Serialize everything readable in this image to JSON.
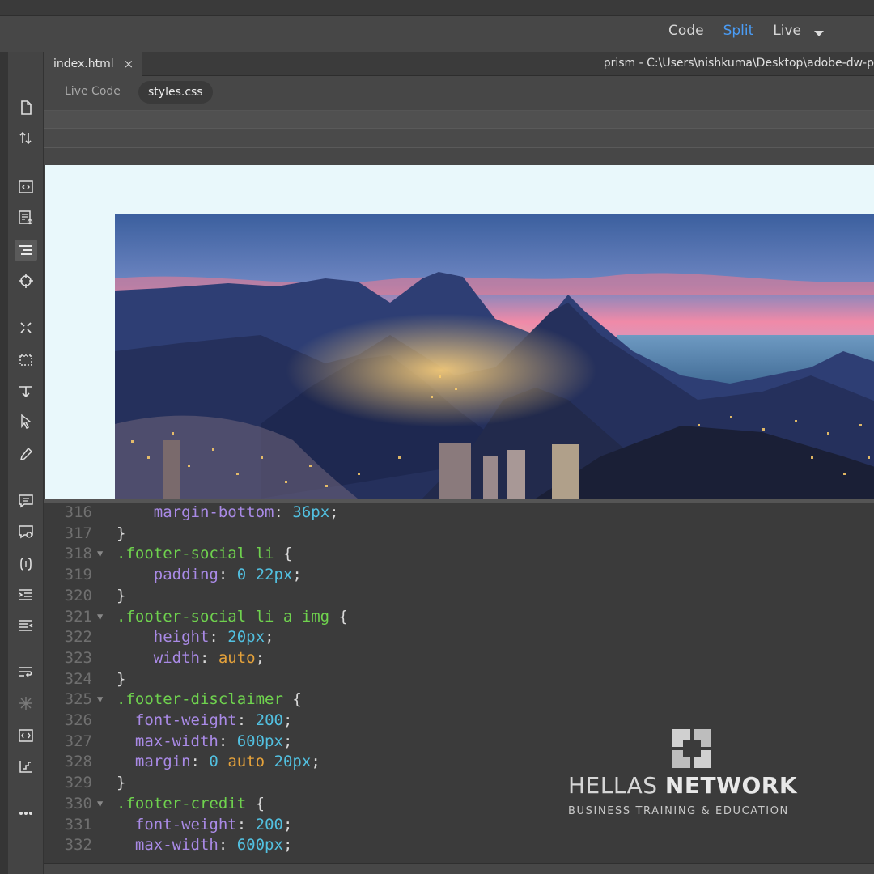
{
  "view_switcher": {
    "code": "Code",
    "split": "Split",
    "live": "Live",
    "active": "Split"
  },
  "document_tab": {
    "filename": "index.html",
    "close_glyph": "×"
  },
  "document_path": "prism - C:\\Users\\nishkuma\\Desktop\\adobe-dw-p",
  "related_files": {
    "live_code": "Live Code",
    "stylesheet": "styles.css"
  },
  "left_toolbar": [
    {
      "icon": "new-file-icon"
    },
    {
      "icon": "expand-collapse-icon"
    },
    {
      "icon": "code-view-icon"
    },
    {
      "icon": "inspect-icon"
    },
    {
      "icon": "format-source-icon",
      "active": true
    },
    {
      "icon": "target-icon"
    },
    {
      "icon": "collapse-selection-icon"
    },
    {
      "icon": "expand-all-icon"
    },
    {
      "icon": "select-parent-tag-icon"
    },
    {
      "icon": "cursor-select-icon"
    },
    {
      "icon": "eyedropper-icon"
    },
    {
      "icon": "comment-icon"
    },
    {
      "icon": "remove-comment-icon"
    },
    {
      "icon": "wrap-tag-icon"
    },
    {
      "icon": "indent-icon"
    },
    {
      "icon": "outdent-icon"
    },
    {
      "icon": "word-wrap-icon"
    },
    {
      "icon": "sparkle-icon"
    },
    {
      "icon": "live-code-icon"
    },
    {
      "icon": "hierarchy-icon"
    },
    {
      "icon": "more-icon"
    }
  ],
  "code_lines": [
    {
      "n": "316",
      "fold": false,
      "indent": "    ",
      "tokens": [
        [
          "prop",
          "margin-bottom"
        ],
        [
          "pun",
          ": "
        ],
        [
          "num",
          "36px"
        ],
        [
          "pun",
          ";"
        ]
      ]
    },
    {
      "n": "317",
      "fold": false,
      "indent": "",
      "tokens": [
        [
          "pun",
          "}"
        ]
      ]
    },
    {
      "n": "318",
      "fold": true,
      "indent": "",
      "tokens": [
        [
          "sel",
          ".footer-social li"
        ],
        [
          "pun",
          " {"
        ]
      ]
    },
    {
      "n": "319",
      "fold": false,
      "indent": "    ",
      "tokens": [
        [
          "prop",
          "padding"
        ],
        [
          "pun",
          ": "
        ],
        [
          "num",
          "0"
        ],
        [
          "pun",
          " "
        ],
        [
          "num",
          "22px"
        ],
        [
          "pun",
          ";"
        ]
      ]
    },
    {
      "n": "320",
      "fold": false,
      "indent": "",
      "tokens": [
        [
          "pun",
          "}"
        ]
      ]
    },
    {
      "n": "321",
      "fold": true,
      "indent": "",
      "tokens": [
        [
          "sel",
          ".footer-social li a img"
        ],
        [
          "pun",
          " {"
        ]
      ]
    },
    {
      "n": "322",
      "fold": false,
      "indent": "    ",
      "tokens": [
        [
          "prop",
          "height"
        ],
        [
          "pun",
          ": "
        ],
        [
          "num",
          "20px"
        ],
        [
          "pun",
          ";"
        ]
      ]
    },
    {
      "n": "323",
      "fold": false,
      "indent": "    ",
      "tokens": [
        [
          "prop",
          "width"
        ],
        [
          "pun",
          ": "
        ],
        [
          "kw",
          "auto"
        ],
        [
          "pun",
          ";"
        ]
      ]
    },
    {
      "n": "324",
      "fold": false,
      "indent": "",
      "tokens": [
        [
          "pun",
          "}"
        ]
      ]
    },
    {
      "n": "325",
      "fold": true,
      "indent": "",
      "tokens": [
        [
          "sel",
          ".footer-disclaimer"
        ],
        [
          "pun",
          " {"
        ]
      ]
    },
    {
      "n": "326",
      "fold": false,
      "indent": "  ",
      "tokens": [
        [
          "prop",
          "font-weight"
        ],
        [
          "pun",
          ": "
        ],
        [
          "num",
          "200"
        ],
        [
          "pun",
          ";"
        ]
      ]
    },
    {
      "n": "327",
      "fold": false,
      "indent": "  ",
      "tokens": [
        [
          "prop",
          "max-width"
        ],
        [
          "pun",
          ": "
        ],
        [
          "num",
          "600px"
        ],
        [
          "pun",
          ";"
        ]
      ]
    },
    {
      "n": "328",
      "fold": false,
      "indent": "  ",
      "tokens": [
        [
          "prop",
          "margin"
        ],
        [
          "pun",
          ": "
        ],
        [
          "num",
          "0"
        ],
        [
          "pun",
          " "
        ],
        [
          "kw",
          "auto"
        ],
        [
          "pun",
          " "
        ],
        [
          "num",
          "20px"
        ],
        [
          "pun",
          ";"
        ]
      ]
    },
    {
      "n": "329",
      "fold": false,
      "indent": "",
      "tokens": [
        [
          "pun",
          "}"
        ]
      ]
    },
    {
      "n": "330",
      "fold": true,
      "indent": "",
      "tokens": [
        [
          "sel",
          ".footer-credit"
        ],
        [
          "pun",
          " {"
        ]
      ]
    },
    {
      "n": "331",
      "fold": false,
      "indent": "  ",
      "tokens": [
        [
          "prop",
          "font-weight"
        ],
        [
          "pun",
          ": "
        ],
        [
          "num",
          "200"
        ],
        [
          "pun",
          ";"
        ]
      ]
    },
    {
      "n": "332",
      "fold": false,
      "indent": "  ",
      "tokens": [
        [
          "prop",
          "max-width"
        ],
        [
          "pun",
          ": "
        ],
        [
          "num",
          "600px"
        ],
        [
          "pun",
          ";"
        ]
      ]
    }
  ],
  "watermark": {
    "name_light": "HELLAS",
    "name_bold": "NETWORK",
    "tagline": "BUSINESS TRAINING & EDUCATION"
  },
  "colors": {
    "accent": "#4a9cf5",
    "selector": "#6fd24e",
    "property": "#a98ae6",
    "number": "#52c0e0",
    "keyword": "#e5a23b",
    "line_number": "#6f6f6f",
    "live_view_bg": "#e9f8fb"
  }
}
